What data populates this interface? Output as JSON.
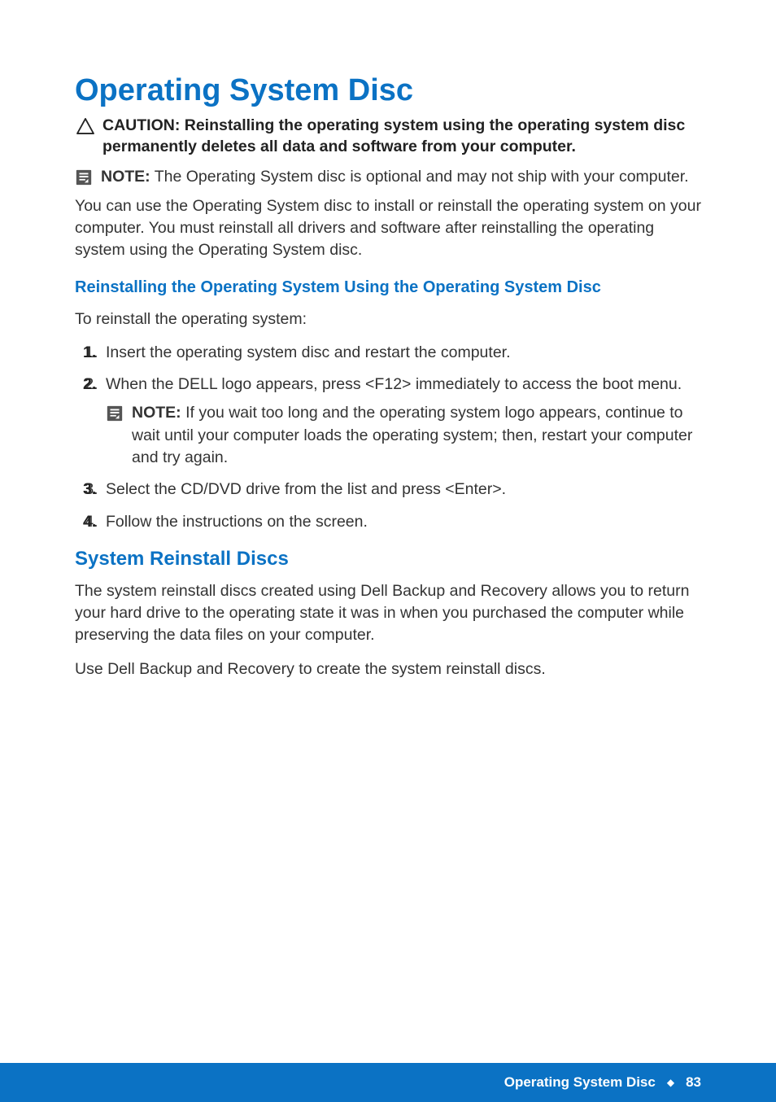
{
  "title": "Operating System Disc",
  "caution": {
    "label": "CAUTION:",
    "text": "Reinstalling the operating system using the operating system disc permanently deletes all data and software from your computer."
  },
  "note1": {
    "label": "NOTE:",
    "text": "The Operating System disc is optional and may not ship with your computer."
  },
  "intro_para": "You can use the Operating System disc to install or reinstall the operating system on your computer. You must reinstall all drivers and software after reinstalling the operating system using the Operating System disc.",
  "subheading1": "Reinstalling the Operating System Using the Operating System Disc",
  "reinstall_intro": "To reinstall the operating system:",
  "steps": [
    "Insert the operating system disc and restart the computer.",
    "When the DELL logo appears, press <F12> immediately to access the boot menu.",
    "Select the CD/DVD drive from the list and press <Enter>.",
    "Follow the instructions on the screen."
  ],
  "nested_note": {
    "label": "NOTE:",
    "text": "If you wait too long and the operating system logo appears, continue to wait until your computer loads the operating system; then, restart your computer and try again."
  },
  "section2_heading": "System Reinstall Discs",
  "section2_para1": "The system reinstall discs created using Dell Backup and Recovery allows you to return your hard drive to the operating state it was in when you purchased the computer while preserving the data files on your computer.",
  "section2_para2": "Use Dell Backup and Recovery to create the system reinstall discs.",
  "footer": {
    "title": "Operating System Disc",
    "page": "83"
  }
}
